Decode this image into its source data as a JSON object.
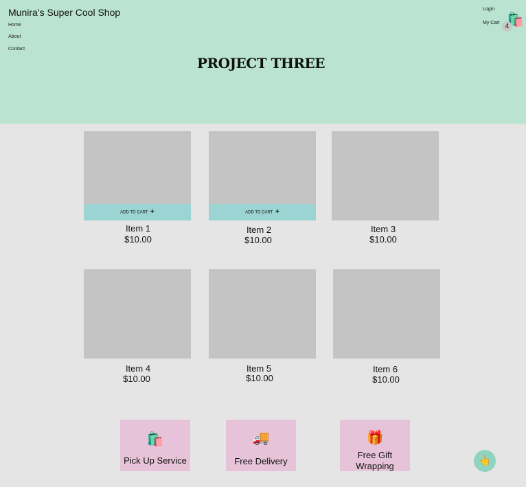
{
  "header": {
    "shop_name": "Munira’s Super Cool Shop",
    "nav": [
      "Home",
      "About",
      "Contact"
    ],
    "title": "PROJECT THREE",
    "login_label": "Login",
    "cart_label": "My Cart",
    "cart_count": "4",
    "cart_icon": "shopping-bags-icon"
  },
  "products": [
    {
      "name": "Item 1",
      "price": "$10.00",
      "add_to_cart_label": "ADD TO CART",
      "plus": "+"
    },
    {
      "name": "Item 2",
      "price": "$10.00",
      "add_to_cart_label": "ADD TO CART",
      "plus": "+"
    },
    {
      "name": "Item 3",
      "price": "$10.00"
    },
    {
      "name": "Item 4",
      "price": "$10.00"
    },
    {
      "name": "Item 5",
      "price": "$10.00"
    },
    {
      "name": "Item 6",
      "price": "$10.00"
    }
  ],
  "features": [
    {
      "label": "Pick Up Service",
      "icon": "shopping-bags-icon",
      "glyph": "🛍️"
    },
    {
      "label": "Free Delivery",
      "icon": "delivery-truck-icon",
      "glyph": "🚚"
    },
    {
      "label": "Free Gift Wrapping",
      "icon": "gift-icon",
      "glyph": "🎁"
    }
  ],
  "fab": {
    "icon": "pointing-hand-icon",
    "glyph": "👆"
  },
  "colors": {
    "header_bg": "#bae3d1",
    "page_bg": "#e5e5e5",
    "card_bg": "#c4c4c4",
    "add_to_cart_bg": "#9bd4d2",
    "feature_bg": "#e6c3d9",
    "fab_bg": "#8fd3c1"
  }
}
